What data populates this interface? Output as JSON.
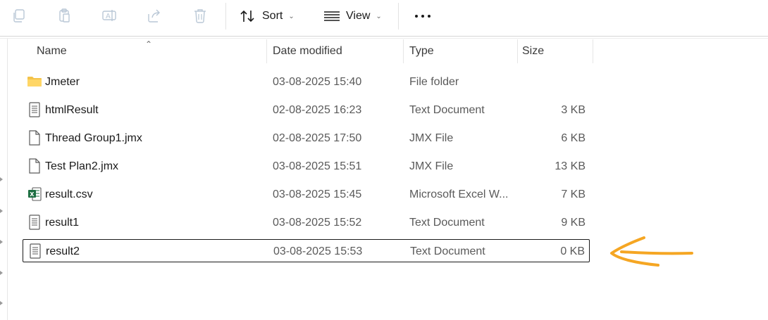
{
  "toolbar": {
    "icons": [
      "copy-icon",
      "paste-icon",
      "rename-icon",
      "share-icon",
      "delete-icon"
    ],
    "sort_label": "Sort",
    "view_label": "View",
    "more_icon": "more-icon"
  },
  "columns": {
    "name": "Name",
    "date": "Date modified",
    "type": "Type",
    "size": "Size"
  },
  "files": [
    {
      "name": "Jmeter",
      "date": "03-08-2025 15:40",
      "type": "File folder",
      "size": "",
      "icon": "folder-icon"
    },
    {
      "name": "htmlResult",
      "date": "02-08-2025 16:23",
      "type": "Text Document",
      "size": "3 KB",
      "icon": "text-file-icon"
    },
    {
      "name": "Thread Group1.jmx",
      "date": "02-08-2025 17:50",
      "type": "JMX File",
      "size": "6 KB",
      "icon": "blank-file-icon"
    },
    {
      "name": "Test Plan2.jmx",
      "date": "03-08-2025 15:51",
      "type": "JMX File",
      "size": "13 KB",
      "icon": "blank-file-icon"
    },
    {
      "name": "result.csv",
      "date": "03-08-2025 15:45",
      "type": "Microsoft Excel W...",
      "size": "7 KB",
      "icon": "excel-file-icon"
    },
    {
      "name": "result1",
      "date": "03-08-2025 15:52",
      "type": "Text Document",
      "size": "9 KB",
      "icon": "text-file-icon"
    },
    {
      "name": "result2",
      "date": "03-08-2025 15:53",
      "type": "Text Document",
      "size": "0 KB",
      "icon": "text-file-icon"
    }
  ],
  "colors": {
    "folder": "#f4c34a",
    "excel": "#1d6f42",
    "annotation": "#f5a623"
  }
}
